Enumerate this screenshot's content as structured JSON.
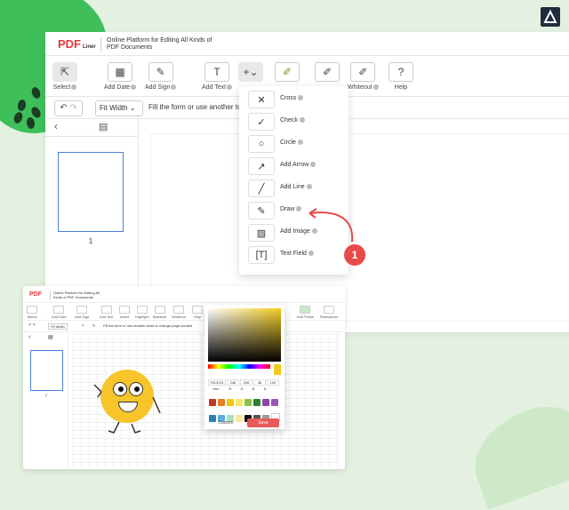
{
  "main": {
    "logo": "PDF",
    "logo_sub": "Liner",
    "tagline": "Online Platform for Editing All Kinds of PDF Documents",
    "tools": [
      {
        "label": "Select",
        "icon": "select-icon"
      },
      {
        "label": "Add Date",
        "icon": "calendar-icon"
      },
      {
        "label": "Add Sign",
        "icon": "sign-icon"
      },
      {
        "label": "Add Text",
        "icon": "text-icon"
      },
      {
        "label": "",
        "icon": "plus-icon"
      },
      {
        "label": "",
        "icon": "highlight-icon"
      },
      {
        "label": "",
        "icon": "blackout-icon"
      },
      {
        "label": "Whiteout",
        "icon": "whiteout-icon"
      },
      {
        "label": "Help",
        "icon": "help-icon"
      }
    ],
    "fit_width": "Fit Width",
    "hint": "Fill the form or use another to",
    "page_number": "1"
  },
  "dropdown": {
    "items": [
      {
        "label": "Cross",
        "icon": "cross-icon"
      },
      {
        "label": "Check",
        "icon": "check-icon"
      },
      {
        "label": "Circle",
        "icon": "circle-icon"
      },
      {
        "label": "Add Arrow",
        "icon": "arrow-icon"
      },
      {
        "label": "Add Line",
        "icon": "line-icon"
      },
      {
        "label": "Draw",
        "icon": "draw-icon"
      },
      {
        "label": "Add Image",
        "icon": "image-icon"
      },
      {
        "label": "Text Field",
        "icon": "textfield-icon"
      }
    ]
  },
  "callout": {
    "number": "1",
    "color": "#e84a4a"
  },
  "second": {
    "logo": "PDF",
    "tagline": "Online Platform for Editing All Kinds of PDF Documents",
    "tools": [
      "Select",
      "Add Date",
      "Add Sign",
      "Add Text",
      "Insert",
      "Highlight",
      "Blackout",
      "Whiteout",
      "Help"
    ],
    "fit_width": "Fit Width",
    "hint": "Fill the form or use another tools to change page content",
    "page_number": "1",
    "right_tools": [
      "Add Fields",
      "Redactions"
    ]
  },
  "picker": {
    "hex": "F6CE24",
    "r": "246",
    "g": "206",
    "b": "36",
    "a": "100",
    "labels": [
      "Hex",
      "R",
      "G",
      "B",
      "A"
    ],
    "custom": "Custom",
    "save": "Save",
    "swatches": [
      "#c0392b",
      "#e67e22",
      "#f1c40f",
      "#f7e86a",
      "#8bc34a",
      "#2e7d32",
      "#8e44ad",
      "#9b59b6",
      "#2980b9",
      "#5dade2",
      "#a9dfbf",
      "#f9e79f",
      "#111111",
      "#555555",
      "#999999",
      "#ffffff"
    ],
    "accent": "#f6ce24"
  }
}
